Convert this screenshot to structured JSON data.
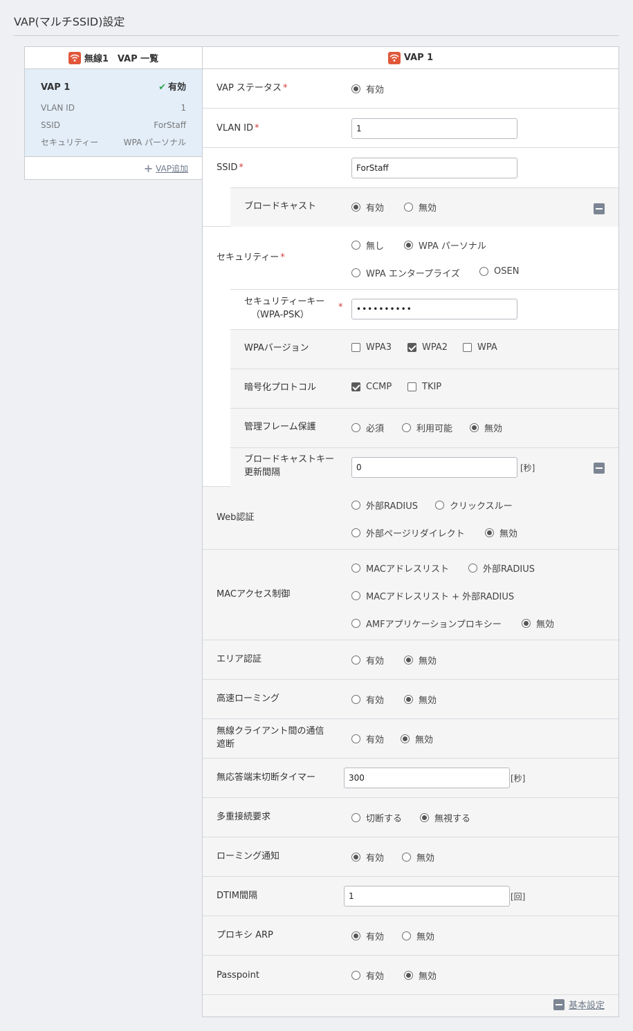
{
  "page": {
    "title": "VAP(マルチSSID)設定"
  },
  "left": {
    "header": "無線1　VAP 一覧",
    "vap": {
      "name": "VAP 1",
      "status": "有効",
      "rows": [
        {
          "label": "VLAN ID",
          "value": "1"
        },
        {
          "label": "SSID",
          "value": "ForStaff"
        },
        {
          "label": "セキュリティー",
          "value": "WPA パーソナル"
        }
      ]
    },
    "add_label": "VAP追加"
  },
  "right": {
    "header": "VAP 1",
    "vap_status": {
      "label": "VAP ステータス",
      "opt1": "有効"
    },
    "vlan_id": {
      "label": "VLAN ID",
      "value": "1"
    },
    "ssid": {
      "label": "SSID",
      "value": "ForStaff"
    },
    "broadcast": {
      "label": "ブロードキャスト",
      "opt1": "有効",
      "opt2": "無効"
    },
    "security": {
      "label": "セキュリティー",
      "opt1": "無し",
      "opt2": "WPA パーソナル",
      "opt3": "WPA エンタープライズ",
      "opt4": "OSEN"
    },
    "key": {
      "label1": "セキュリティーキー",
      "label2": "（WPA-PSK）",
      "value": "••••••••••"
    },
    "wpa_version": {
      "label": "WPAバージョン",
      "opt1": "WPA3",
      "opt2": "WPA2",
      "opt3": "WPA"
    },
    "cipher": {
      "label": "暗号化プロトコル",
      "opt1": "CCMP",
      "opt2": "TKIP"
    },
    "pmf": {
      "label": "管理フレーム保護",
      "opt1": "必須",
      "opt2": "利用可能",
      "opt3": "無効"
    },
    "bcast_key": {
      "label1": "ブロードキャストキー",
      "label2": "更新間隔",
      "value": "0",
      "unit": "[秒]"
    },
    "web_auth": {
      "label": "Web認証",
      "opt1": "外部RADIUS",
      "opt2": "クリックスルー",
      "opt3": "外部ページリダイレクト",
      "opt4": "無効"
    },
    "mac_access": {
      "label": "MACアクセス制御",
      "opt1": "MACアドレスリスト",
      "opt2": "外部RADIUS",
      "opt3": "MACアドレスリスト + 外部RADIUS",
      "opt4": "AMFアプリケーションプロキシー",
      "opt5": "無効"
    },
    "area_auth": {
      "label": "エリア認証",
      "opt1": "有効",
      "opt2": "無効"
    },
    "fast_roaming": {
      "label": "高速ローミング",
      "opt1": "有効",
      "opt2": "無効"
    },
    "isolation": {
      "label1": "無線クライアント間の通信",
      "label2": "遮断",
      "opt1": "有効",
      "opt2": "無効"
    },
    "idle_timer": {
      "label": "無応答端末切断タイマー",
      "value": "300",
      "unit": "[秒]"
    },
    "multi_conn": {
      "label": "多重接続要求",
      "opt1": "切断する",
      "opt2": "無視する"
    },
    "roam_notify": {
      "label": "ローミング通知",
      "opt1": "有効",
      "opt2": "無効"
    },
    "dtim": {
      "label": "DTIM間隔",
      "value": "1",
      "unit": "[回]"
    },
    "proxy_arp": {
      "label": "プロキシ ARP",
      "opt1": "有効",
      "opt2": "無効"
    },
    "passpoint": {
      "label": "Passpoint",
      "opt1": "有効",
      "opt2": "無効"
    },
    "basic_settings": "基本設定"
  }
}
